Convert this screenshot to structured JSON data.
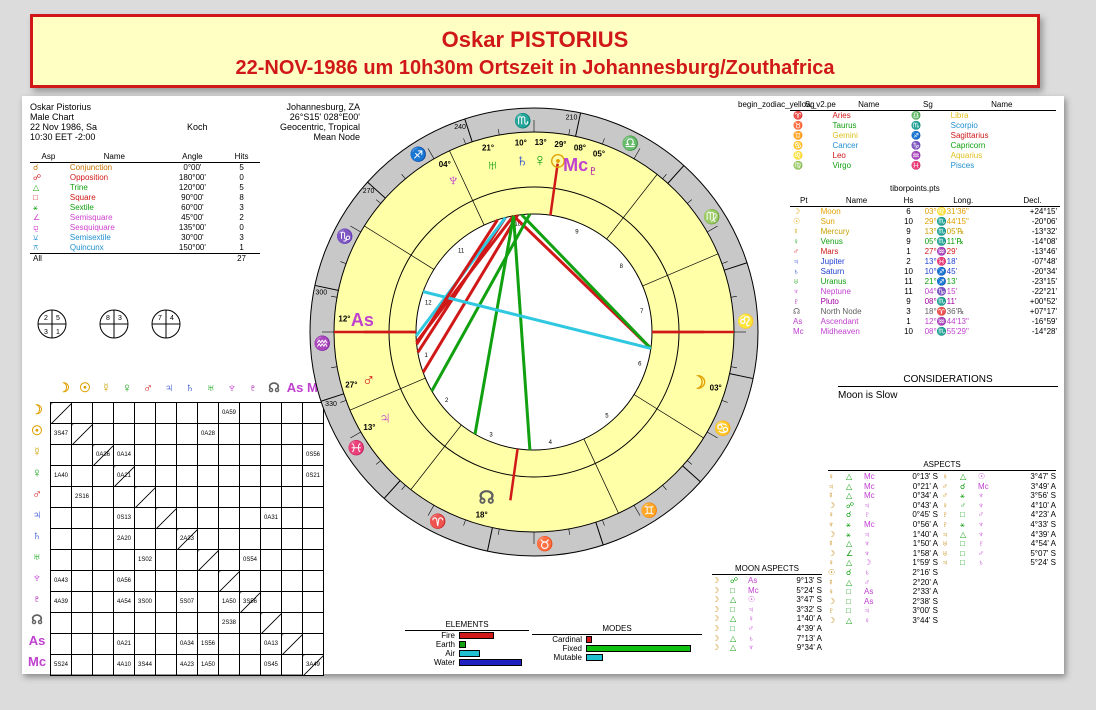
{
  "banner": {
    "title": "Oskar PISTORIUS",
    "subtitle": "22-NOV-1986 um 10h30m Ortszeit in Johannesburg/Zouthafrica"
  },
  "header": {
    "name": "Oskar Pistorius",
    "chart_type": "Male Chart",
    "date": "22 Nov 1986, Sa",
    "time": "10:30 EET -2:00",
    "house_system": "Koch",
    "place": "Johannesburg, ZA",
    "coords": "26°S15' 028°E00'",
    "system": "Geocentric, Tropical",
    "node": "Mean Node",
    "file": "begin_zodiac_yellow_v2.pe"
  },
  "aspect_table": {
    "headers": [
      "Asp",
      "Name",
      "Angle",
      "Hits"
    ],
    "rows": [
      {
        "sym": "☌",
        "name": "Conjunction",
        "angle": "0°00'",
        "hits": "5",
        "color": "#c87000"
      },
      {
        "sym": "☍",
        "name": "Opposition",
        "angle": "180°00'",
        "hits": "0",
        "color": "#d01818"
      },
      {
        "sym": "△",
        "name": "Trine",
        "angle": "120°00'",
        "hits": "5",
        "color": "#10a010"
      },
      {
        "sym": "□",
        "name": "Square",
        "angle": "90°00'",
        "hits": "8",
        "color": "#d01818"
      },
      {
        "sym": "⚹",
        "name": "Sextile",
        "angle": "60°00'",
        "hits": "3",
        "color": "#10a010"
      },
      {
        "sym": "∠",
        "name": "Semisquare",
        "angle": "45°00'",
        "hits": "2",
        "color": "#d040d0"
      },
      {
        "sym": "⚼",
        "name": "Sesquiquare",
        "angle": "135°00'",
        "hits": "0",
        "color": "#d040d0"
      },
      {
        "sym": "⚺",
        "name": "Semisextile",
        "angle": "30°00'",
        "hits": "3",
        "color": "#2090d0"
      },
      {
        "sym": "⚻",
        "name": "Quincunx",
        "angle": "150°00'",
        "hits": "1",
        "color": "#2090d0"
      }
    ],
    "total_label": "All",
    "total": "27"
  },
  "quadrants": [
    [
      "2",
      "5",
      "3",
      "1"
    ],
    [
      "8",
      "3",
      "",
      ""
    ],
    [
      "7",
      "4",
      "",
      ""
    ]
  ],
  "zodiac_table": {
    "headers": [
      "Sg",
      "Name",
      "Sg",
      "Name"
    ],
    "rows": [
      [
        "♈",
        "Aries",
        "♎",
        "Libra"
      ],
      [
        "♉",
        "Taurus",
        "♏",
        "Scorpio"
      ],
      [
        "♊",
        "Gemini",
        "♐",
        "Sagittarius"
      ],
      [
        "♋",
        "Cancer",
        "♑",
        "Capricorn"
      ],
      [
        "♌",
        "Leo",
        "♒",
        "Aquarius"
      ],
      [
        "♍",
        "Virgo",
        "♓",
        "Pisces"
      ]
    ],
    "colors": [
      "#d01818",
      "#10a010",
      "#e0c020",
      "#2090d0",
      "#d01818",
      "#10a010",
      "#e0c020",
      "#2090d0",
      "#d01818",
      "#10a010",
      "#e0c020",
      "#2090d0"
    ]
  },
  "planets_table": {
    "file": "tiborpoints.pts",
    "headers": [
      "Pt",
      "Name",
      "Hs",
      "Long.",
      "Decl."
    ],
    "rows": [
      {
        "sym": "☽",
        "name": "Moon",
        "hs": "6",
        "long": "03°♌31'36\"",
        "decl": "+24°15'",
        "color": "#e0a000"
      },
      {
        "sym": "☉",
        "name": "Sun",
        "hs": "10",
        "long": "29°♏44'15\"",
        "decl": "-20°06'",
        "color": "#e0a000"
      },
      {
        "sym": "☿",
        "name": "Mercury",
        "hs": "9",
        "long": "13°♏05'℞",
        "decl": "-13°32'",
        "color": "#c8a000"
      },
      {
        "sym": "♀",
        "name": "Venus",
        "hs": "9",
        "long": "05°♏11'℞",
        "decl": "-14°08'",
        "color": "#10a010"
      },
      {
        "sym": "♂",
        "name": "Mars",
        "hs": "1",
        "long": "27°♒29'",
        "decl": "-13°46'",
        "color": "#d01818"
      },
      {
        "sym": "♃",
        "name": "Jupiter",
        "hs": "2",
        "long": "13°♓18'",
        "decl": "-07°48'",
        "color": "#2040d0"
      },
      {
        "sym": "♄",
        "name": "Saturn",
        "hs": "10",
        "long": "10°♐45'",
        "decl": "-20°34'",
        "color": "#2040d0"
      },
      {
        "sym": "♅",
        "name": "Uranus",
        "hs": "11",
        "long": "21°♐13'",
        "decl": "-23°15'",
        "color": "#10a010"
      },
      {
        "sym": "♆",
        "name": "Neptune",
        "hs": "11",
        "long": "04°♑15'",
        "decl": "-22°21'",
        "color": "#c040d0"
      },
      {
        "sym": "♇",
        "name": "Pluto",
        "hs": "9",
        "long": "08°♏11'",
        "decl": "+00°52'",
        "color": "#a000a0"
      },
      {
        "sym": "☊",
        "name": "North Node",
        "hs": "3",
        "long": "18°♈36'℞",
        "decl": "+07°17'",
        "color": "#606060"
      },
      {
        "sym": "As",
        "name": "Ascendant",
        "hs": "1",
        "long": "12°♒44'13\"",
        "decl": "-16°59'",
        "color": "#c040d0"
      },
      {
        "sym": "Mc",
        "name": "Midheaven",
        "hs": "10",
        "long": "08°♏55'29\"",
        "decl": "-14°28'",
        "color": "#c040d0"
      }
    ]
  },
  "considerations": {
    "title": "CONSIDERATIONS",
    "text": "Moon is Slow"
  },
  "aspects_list": {
    "title": "ASPECTS",
    "col1": [
      [
        "♀",
        "△",
        "Mc",
        "0°13' S"
      ],
      [
        "♃",
        "△",
        "Mc",
        "0°21' A"
      ],
      [
        "☿",
        "△",
        "Mc",
        "0°34' A"
      ],
      [
        "☽",
        "☍",
        "♃",
        "0°43' A"
      ],
      [
        "♀",
        "☌",
        "♇",
        "0°45' S"
      ],
      [
        "♆",
        "⚹",
        "Mc",
        "0°56' A"
      ],
      [
        "☽",
        "⚹",
        "♃",
        "1°40' A"
      ],
      [
        "☿",
        "△",
        "♆",
        "1°50' A"
      ],
      [
        "☽",
        "∠",
        "♆",
        "1°58' A"
      ],
      [
        "♀",
        "△",
        "☽",
        "1°59' S"
      ],
      [
        "☉",
        "☌",
        "♄",
        "2°16' S"
      ],
      [
        "☿",
        "△",
        "♂",
        "2°20' A"
      ],
      [
        "♀",
        "□",
        "As",
        "2°33' A"
      ],
      [
        "☽",
        "□",
        "As",
        "2°38' S"
      ],
      [
        "♇",
        "□",
        "♃",
        "3°00' S"
      ],
      [
        "☽",
        "△",
        "♀",
        "3°44' S"
      ]
    ],
    "col2": [
      [
        "♀",
        "△",
        "☉",
        "3°47' S"
      ],
      [
        "♂",
        "☌",
        "Mc",
        "3°49' A"
      ],
      [
        "♂",
        "⚹",
        "♆",
        "3°56' S"
      ],
      [
        "♀",
        "♂",
        "♆",
        "4°10' A"
      ],
      [
        "♇",
        "□",
        "♂",
        "4°23' A"
      ],
      [
        "♇",
        "⚹",
        "♆",
        "4°33' S"
      ],
      [
        "♃",
        "△",
        "♆",
        "4°39' A"
      ],
      [
        "♅",
        "□",
        "♇",
        "4°54' A"
      ],
      [
        "♅",
        "□",
        "♂",
        "5°07' S"
      ],
      [
        "♃",
        "□",
        "♄",
        "5°24' S"
      ]
    ]
  },
  "moon_aspects": {
    "title": "MOON ASPECTS",
    "rows": [
      [
        "☽",
        "☍",
        "As",
        "9°13' S"
      ],
      [
        "☽",
        "□",
        "Mc",
        "5°24' S"
      ],
      [
        "☽",
        "△",
        "☉",
        "3°47' S"
      ],
      [
        "☽",
        "□",
        "♃",
        "3°32' S"
      ],
      [
        "☽",
        "△",
        "♀",
        "1°40' A"
      ],
      [
        "☽",
        "□",
        "♂",
        "4°39' A"
      ],
      [
        "☽",
        "△",
        "♄",
        "7°13' A"
      ],
      [
        "☽",
        "△",
        "♆",
        "9°34' A"
      ]
    ]
  },
  "elements": {
    "title": "ELEMENTS",
    "labels": [
      "Fire",
      "Earth",
      "Air",
      "Water"
    ],
    "values": [
      0.5,
      0.1,
      0.3,
      0.9
    ],
    "colors": [
      "#d01818",
      "#10a010",
      "#20c0d0",
      "#2020c0"
    ]
  },
  "modes": {
    "title": "MODES",
    "labels": [
      "Cardinal",
      "Fixed",
      "Mutable"
    ],
    "values": [
      0.05,
      0.95,
      0.15
    ],
    "colors": [
      "#d01818",
      "#10c010",
      "#20c0d0"
    ]
  },
  "grid": {
    "planets": [
      "☽",
      "☉",
      "☿",
      "♀",
      "♂",
      "♃",
      "♄",
      "♅",
      "♆",
      "♇",
      "☊",
      "As",
      "Mc"
    ],
    "planet_colors": [
      "#e0a000",
      "#e0a000",
      "#c8a000",
      "#10a010",
      "#d01818",
      "#2040d0",
      "#2040d0",
      "#10a010",
      "#c040d0",
      "#a000a0",
      "#606060",
      "#c040d0",
      "#c040d0"
    ],
    "cells": [
      {
        "r": 0,
        "c": 8,
        "t": "0A59"
      },
      {
        "r": 1,
        "c": 0,
        "t": "3S47"
      },
      {
        "r": 1,
        "c": 7,
        "t": "0A28"
      },
      {
        "r": 2,
        "c": 2,
        "t": "0A36"
      },
      {
        "r": 2,
        "c": 3,
        "t": "0A14"
      },
      {
        "r": 2,
        "c": 12,
        "t": "0S56"
      },
      {
        "r": 3,
        "c": 0,
        "t": "1A40"
      },
      {
        "r": 3,
        "c": 3,
        "t": "0A21"
      },
      {
        "r": 3,
        "c": 12,
        "t": "0S21"
      },
      {
        "r": 4,
        "c": 1,
        "t": "2S16"
      },
      {
        "r": 5,
        "c": 3,
        "t": "0S13"
      },
      {
        "r": 5,
        "c": 10,
        "t": "0A31"
      },
      {
        "r": 6,
        "c": 3,
        "t": "2A20"
      },
      {
        "r": 6,
        "c": 6,
        "t": "2A33"
      },
      {
        "r": 7,
        "c": 4,
        "t": "1S02"
      },
      {
        "r": 7,
        "c": 9,
        "t": "0S54"
      },
      {
        "r": 8,
        "c": 0,
        "t": "0A43"
      },
      {
        "r": 8,
        "c": 3,
        "t": "0A56"
      },
      {
        "r": 9,
        "c": 0,
        "t": "4A39"
      },
      {
        "r": 9,
        "c": 3,
        "t": "4A54"
      },
      {
        "r": 9,
        "c": 4,
        "t": "3S00"
      },
      {
        "r": 9,
        "c": 6,
        "t": "5S07"
      },
      {
        "r": 9,
        "c": 8,
        "t": "1A50"
      },
      {
        "r": 9,
        "c": 9,
        "t": "3S56"
      },
      {
        "r": 10,
        "c": 8,
        "t": "2S38"
      },
      {
        "r": 11,
        "c": 3,
        "t": "0A21"
      },
      {
        "r": 11,
        "c": 6,
        "t": "0A34"
      },
      {
        "r": 11,
        "c": 7,
        "t": "1S56"
      },
      {
        "r": 11,
        "c": 10,
        "t": "0A13"
      },
      {
        "r": 12,
        "c": 0,
        "t": "5S24"
      },
      {
        "r": 12,
        "c": 3,
        "t": "4A10"
      },
      {
        "r": 12,
        "c": 4,
        "t": "3S44"
      },
      {
        "r": 12,
        "c": 6,
        "t": "4A23"
      },
      {
        "r": 12,
        "c": 7,
        "t": "1A50"
      },
      {
        "r": 12,
        "c": 10,
        "t": "0S45"
      },
      {
        "r": 12,
        "c": 12,
        "t": "3A49"
      }
    ]
  },
  "wheel": {
    "zodiac_glyphs": [
      "♈",
      "♉",
      "♊",
      "♋",
      "♌",
      "♍",
      "♎",
      "♏",
      "♐",
      "♑",
      "♒",
      "♓"
    ],
    "ticks": [
      "210",
      "240",
      "270",
      "300",
      "330"
    ],
    "house_numbers": [
      "1",
      "2",
      "3",
      "4",
      "5",
      "6",
      "7",
      "8",
      "9",
      "10",
      "11",
      "12"
    ],
    "planet_labels": [
      {
        "sym": "☉",
        "deg": "29°",
        "color": "#e0a000"
      },
      {
        "sym": "♄",
        "deg": "10°",
        "color": "#2040d0"
      },
      {
        "sym": "♅",
        "deg": "21°",
        "color": "#10a010"
      },
      {
        "sym": "♆",
        "deg": "04°",
        "color": "#c040d0"
      },
      {
        "sym": "As",
        "deg": "12°",
        "color": "#c040d0"
      },
      {
        "sym": "♂",
        "deg": "27°",
        "color": "#d01818"
      },
      {
        "sym": "♃",
        "deg": "13°",
        "color": "#c040d0"
      },
      {
        "sym": "☊",
        "deg": "18°",
        "color": "#606060"
      },
      {
        "sym": "☽",
        "deg": "03°",
        "color": "#e0a000"
      },
      {
        "sym": "Mc",
        "deg": "08°",
        "color": "#c040d0"
      },
      {
        "sym": "♇",
        "deg": "05°",
        "color": "#a000a0"
      },
      {
        "sym": "♀",
        "deg": "13°",
        "color": "#10a010"
      }
    ]
  }
}
